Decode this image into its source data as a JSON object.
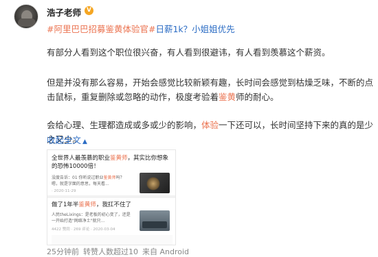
{
  "author": {
    "name": "浩子老师",
    "badge": "V"
  },
  "headline": {
    "topic": "#阿里巴巴招募鉴黄体验官#",
    "link": "日薪1k？小姐姐优先"
  },
  "paragraphs": {
    "p1": "有部分人看到这个职位很兴奋，有人看到很避讳，有人看到羡慕这个薪资。",
    "p2_a": "但是并没有那么容易，开始会感觉比较新颖有趣，长时间会感觉到枯燥乏味，不断的点击鼠标，重复删除或忽略的动作，极度考验着",
    "p2_hl": "鉴黄",
    "p2_b": "师的耐心。",
    "p3_a": "会给心理、生理都造成或多或少的影响，",
    "p3_hl": "体验",
    "p3_b": "一下还可以，长时间坚持下来的真的是少之又少。"
  },
  "collapse": {
    "label": "收起全文",
    "icon": "chevron-up-icon"
  },
  "embed": {
    "card1": {
      "title_a": "全世界人最羡慕的职业",
      "title_hl": "鉴黄师",
      "title_b": "，其实比你想象的恐怖10000倍！",
      "desc_a": "没度告诉：01 你听说过职业",
      "desc_hl": "鉴黄师",
      "desc_b": "吗？ 嗯，就是字面的意思，每天看...",
      "meta": "· 2020-11-29"
    },
    "card2": {
      "title_a": "做了1年半",
      "title_hl": "鉴黄师",
      "title_b": "，我扛不住了",
      "desc": "人民theLixings：是老板的初心变了，还是一开始打造\"网络净土\"就只...",
      "meta": "4422 赞同 · 269 评论 · 2020-03-04"
    }
  },
  "footer": {
    "time": "25分钟前",
    "reposts": "转赞人数超过10",
    "source": "来自 Android"
  },
  "colors": {
    "topic": "#eb7350",
    "link": "#2b6cc4",
    "badge": "#f5a623"
  }
}
